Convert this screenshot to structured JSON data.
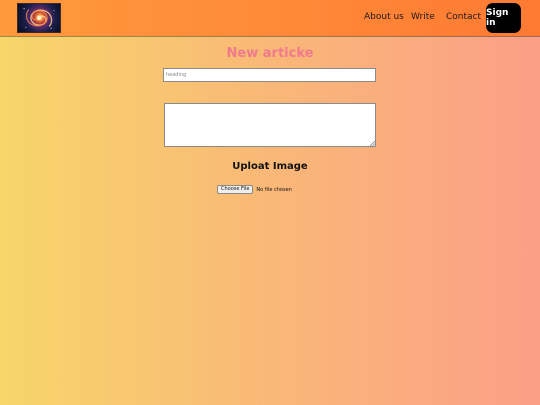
{
  "navbar": {
    "logo_icon": "galaxy-logo-icon",
    "links": [
      "About us",
      "Write",
      "Contact"
    ],
    "signin_label": "Sign in"
  },
  "form": {
    "title": "New articke",
    "heading_placeholder": "heading",
    "body_value": "",
    "upload_title": "Uploat Image",
    "file_button_label": "Choose File",
    "file_status": "No file chosen"
  },
  "colors": {
    "navbar_gradient": [
      "#ff9a3c",
      "#ff7a33"
    ],
    "page_gradient": [
      "#f7d66a",
      "#f9b877",
      "#fb9f86"
    ],
    "title_color": "#f07a8c",
    "signin_bg": "#000000"
  }
}
